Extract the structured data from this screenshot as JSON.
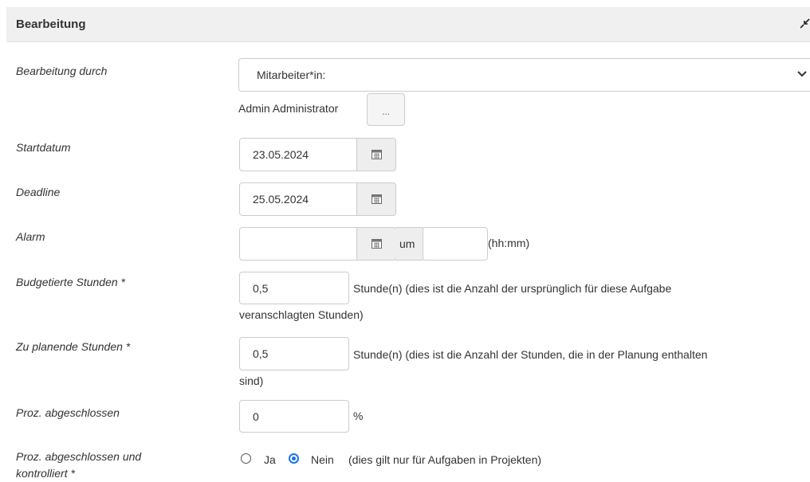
{
  "section": {
    "title": "Bearbeitung"
  },
  "fields": {
    "bearbeitung_durch": {
      "label": "Bearbeitung durch",
      "select_value": "Mitarbeiter*in:",
      "assignee": "Admin Administrator",
      "picker_label": "..."
    },
    "startdatum": {
      "label": "Startdatum",
      "value": "23.05.2024"
    },
    "deadline": {
      "label": "Deadline",
      "value": "25.05.2024"
    },
    "alarm": {
      "label": "Alarm",
      "date_value": "",
      "um_label": "um",
      "time_value": "",
      "time_format": "(hh:mm)"
    },
    "budgetierte_stunden": {
      "label": "Budgetierte Stunden *",
      "value": "0,5",
      "help_line1": "Stunde(n) (dies ist die Anzahl der ursprünglich für diese Aufgabe",
      "help_line2": "veranschlagten Stunden)"
    },
    "zu_planende_stunden": {
      "label": "Zu planende Stunden *",
      "value": "0,5",
      "help_line1": "Stunde(n) (dies ist die Anzahl der Stunden, die in der Planung enthalten",
      "help_line2": "sind)"
    },
    "proz_abgeschlossen": {
      "label": "Proz. abgeschlossen",
      "value": "0",
      "unit": "%"
    },
    "proz_kontrolliert": {
      "label_line1": "Proz. abgeschlossen und",
      "label_line2": "kontrolliert *",
      "options": [
        {
          "label": "Ja",
          "selected": false
        },
        {
          "label": "Nein",
          "selected": true
        }
      ],
      "note": "(dies gilt nur für Aufgaben in Projekten)"
    }
  },
  "colors": {
    "accent": "#1a73e8",
    "header_bg": "#f0f0f0",
    "border": "#cccccc"
  },
  "icons": [
    "collapse-icon",
    "chevron-down-icon",
    "calendar-icon"
  ]
}
